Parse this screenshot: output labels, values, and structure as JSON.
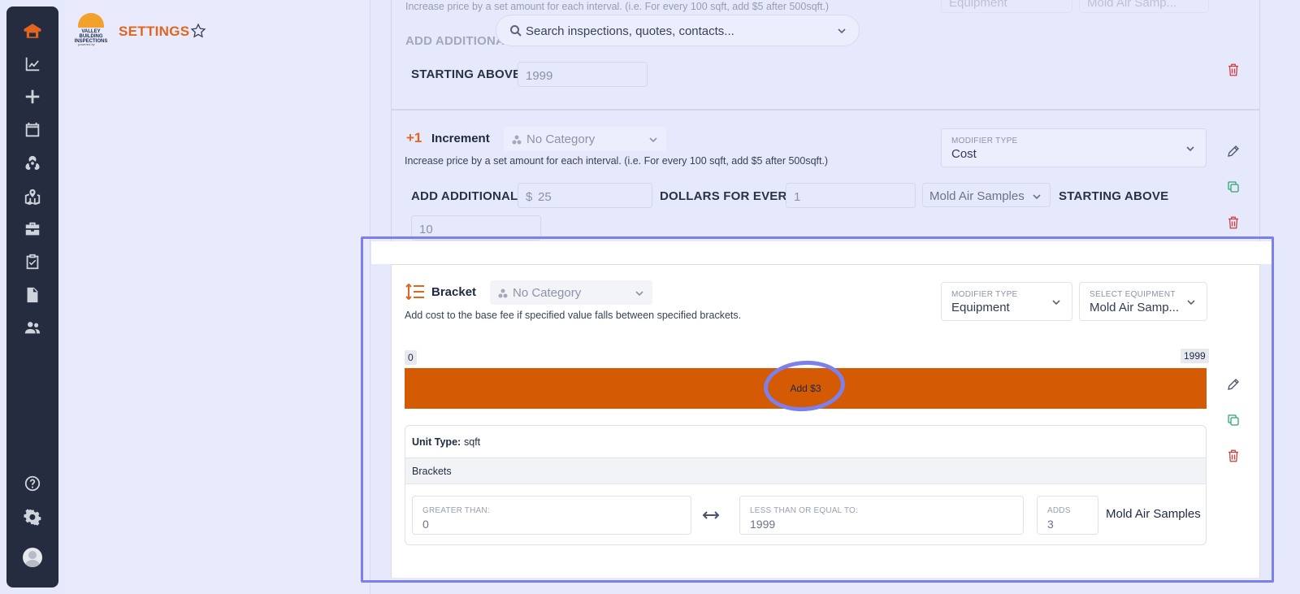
{
  "header": {
    "brand_line1": "VALLEY BUILDING",
    "brand_line2": "INSPECTIONS",
    "brand_sub": "powered by",
    "title": "SETTINGS",
    "search_placeholder": "Search inspections, quotes, contacts..."
  },
  "sidebar": {
    "items": [
      "home",
      "analytics",
      "add",
      "calendar",
      "radiation",
      "map",
      "briefcase",
      "checklist",
      "document",
      "users",
      "help",
      "settings",
      "avatar"
    ]
  },
  "top_card": {
    "faded_desc": "Increase price by a set amount for each interval. (i.e. For every 100 sqft, add $5 after 500sqft.)",
    "faded_label": "ADD ADDITIONAL",
    "faded_sel1": "Equipment",
    "faded_sel2": "Mold Air Samp...",
    "starting_above_label": "STARTING ABOVE",
    "starting_above_value": "1999"
  },
  "increment": {
    "icon": "+1",
    "title": "Increment",
    "category": "No Category",
    "description": "Increase price by a set amount for each interval. (i.e. For every 100 sqft, add $5 after 500sqft.)",
    "modifier_type_label": "MODIFIER TYPE",
    "modifier_type_value": "Cost",
    "add_additional_label": "ADD ADDITIONAL",
    "currency": "$",
    "amount": "25",
    "dollars_for_every_label": "DOLLARS FOR EVERY",
    "interval": "1",
    "equipment": "Mold Air Samples",
    "starting_above_label": "STARTING ABOVE",
    "starting_above_value": "10"
  },
  "bracket": {
    "title": "Bracket",
    "category": "No Category",
    "description": "Add cost to the base fee if specified value falls between specified brackets.",
    "modifier_type_label": "MODIFIER TYPE",
    "modifier_type_value": "Equipment",
    "select_equipment_label": "SELECT EQUIPMENT",
    "select_equipment_value": "Mold Air Samp...",
    "range_min": "0",
    "range_max": "1999",
    "range_text": "Add $3",
    "unit_type_label": "Unit Type:",
    "unit_type_value": "sqft",
    "brackets_label": "Brackets",
    "greater_than_label": "GREATER THAN:",
    "greater_than_value": "0",
    "less_than_label": "LESS THAN OR EQUAL TO:",
    "less_than_value": "1999",
    "adds_label": "ADDS",
    "adds_value": "3",
    "equipment_name": "Mold Air Samples"
  },
  "colors": {
    "accent": "#e0661f",
    "bar": "#d45a04",
    "highlight": "#7c80ec",
    "sidebar": "#262c3f"
  }
}
